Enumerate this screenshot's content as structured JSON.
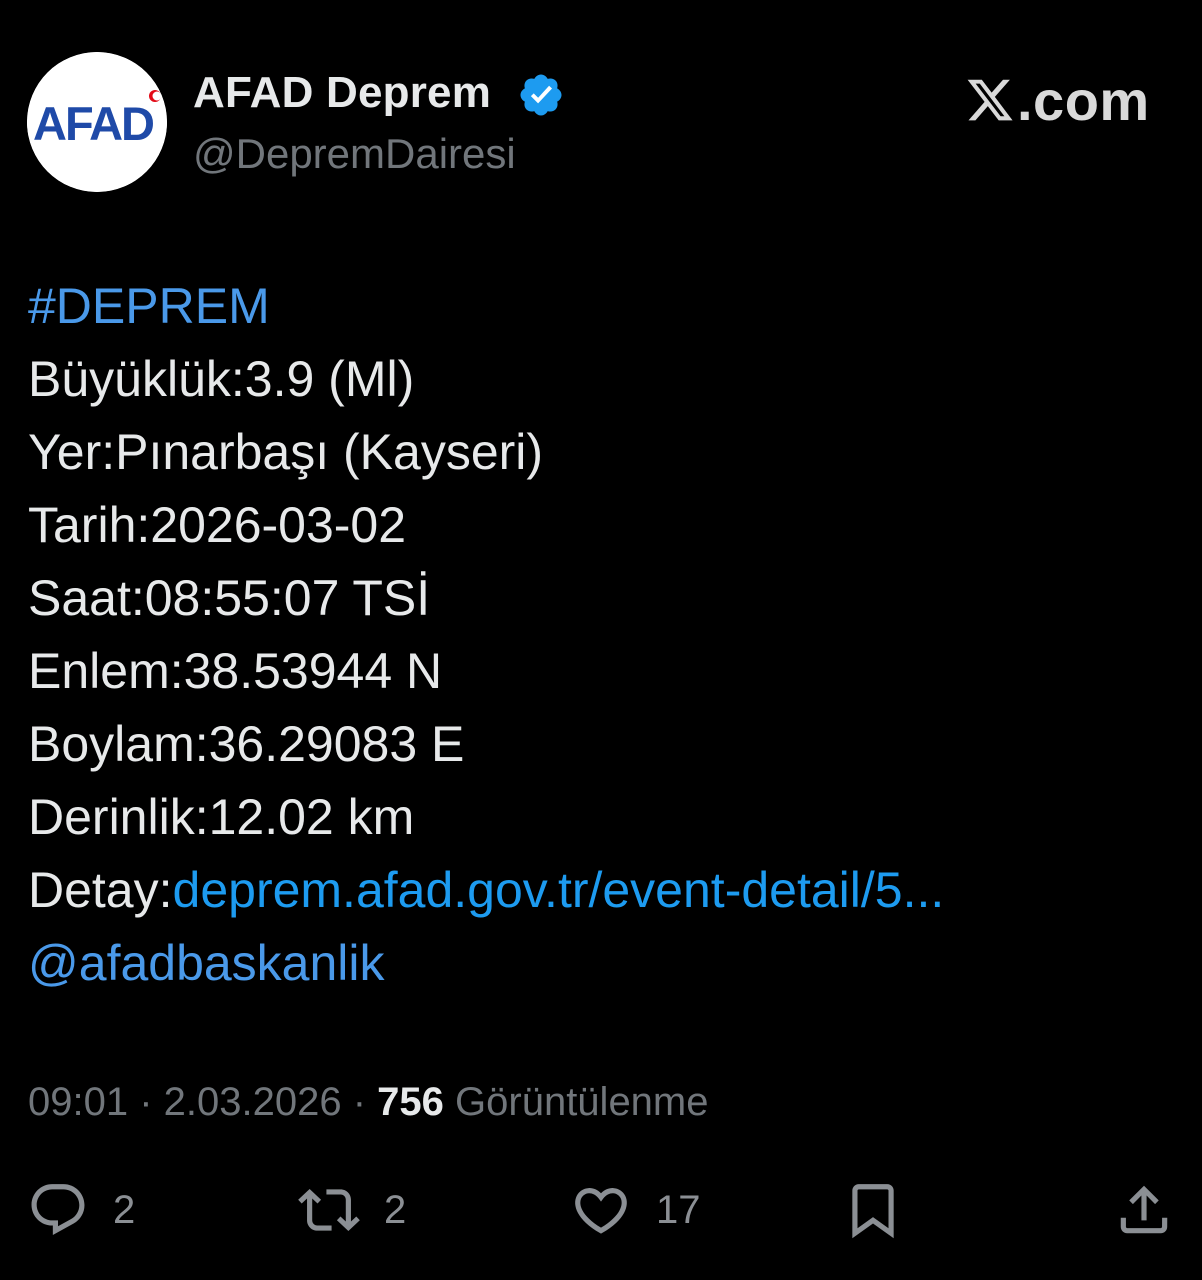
{
  "author": {
    "name": "AFAD Deprem",
    "handle": "@DepremDairesi",
    "avatar_text": "AFAD",
    "verified": true
  },
  "site": {
    "domain_text": ".com",
    "logo": "x-logo"
  },
  "tweet": {
    "hashtag": "#DEPREM",
    "lines": [
      "Büyüklük:3.9 (Ml)",
      "Yer:Pınarbaşı (Kayseri)",
      "Tarih:2026-03-02",
      "Saat:08:55:07 TSİ",
      "Enlem:38.53944 N",
      "Boylam:36.29083 E",
      "Derinlik:12.02 km"
    ],
    "detail_label": "Detay:",
    "detail_link": "deprem.afad.gov.tr/event-detail/5...",
    "mention": "@afadbaskanlik"
  },
  "meta": {
    "time": "09:01",
    "separator": " · ",
    "date": "2.03.2026",
    "views_count": "756",
    "views_label": " Görüntülenme"
  },
  "actions": {
    "reply_count": "2",
    "repost_count": "2",
    "like_count": "17"
  },
  "colors": {
    "background": "#000000",
    "text": "#e7e9ea",
    "secondary": "#71767b",
    "link": "#1d9bf0",
    "verified": "#1d9bf0",
    "brand_blue": "#1f4aa8",
    "brand_red": "#e30a17"
  }
}
